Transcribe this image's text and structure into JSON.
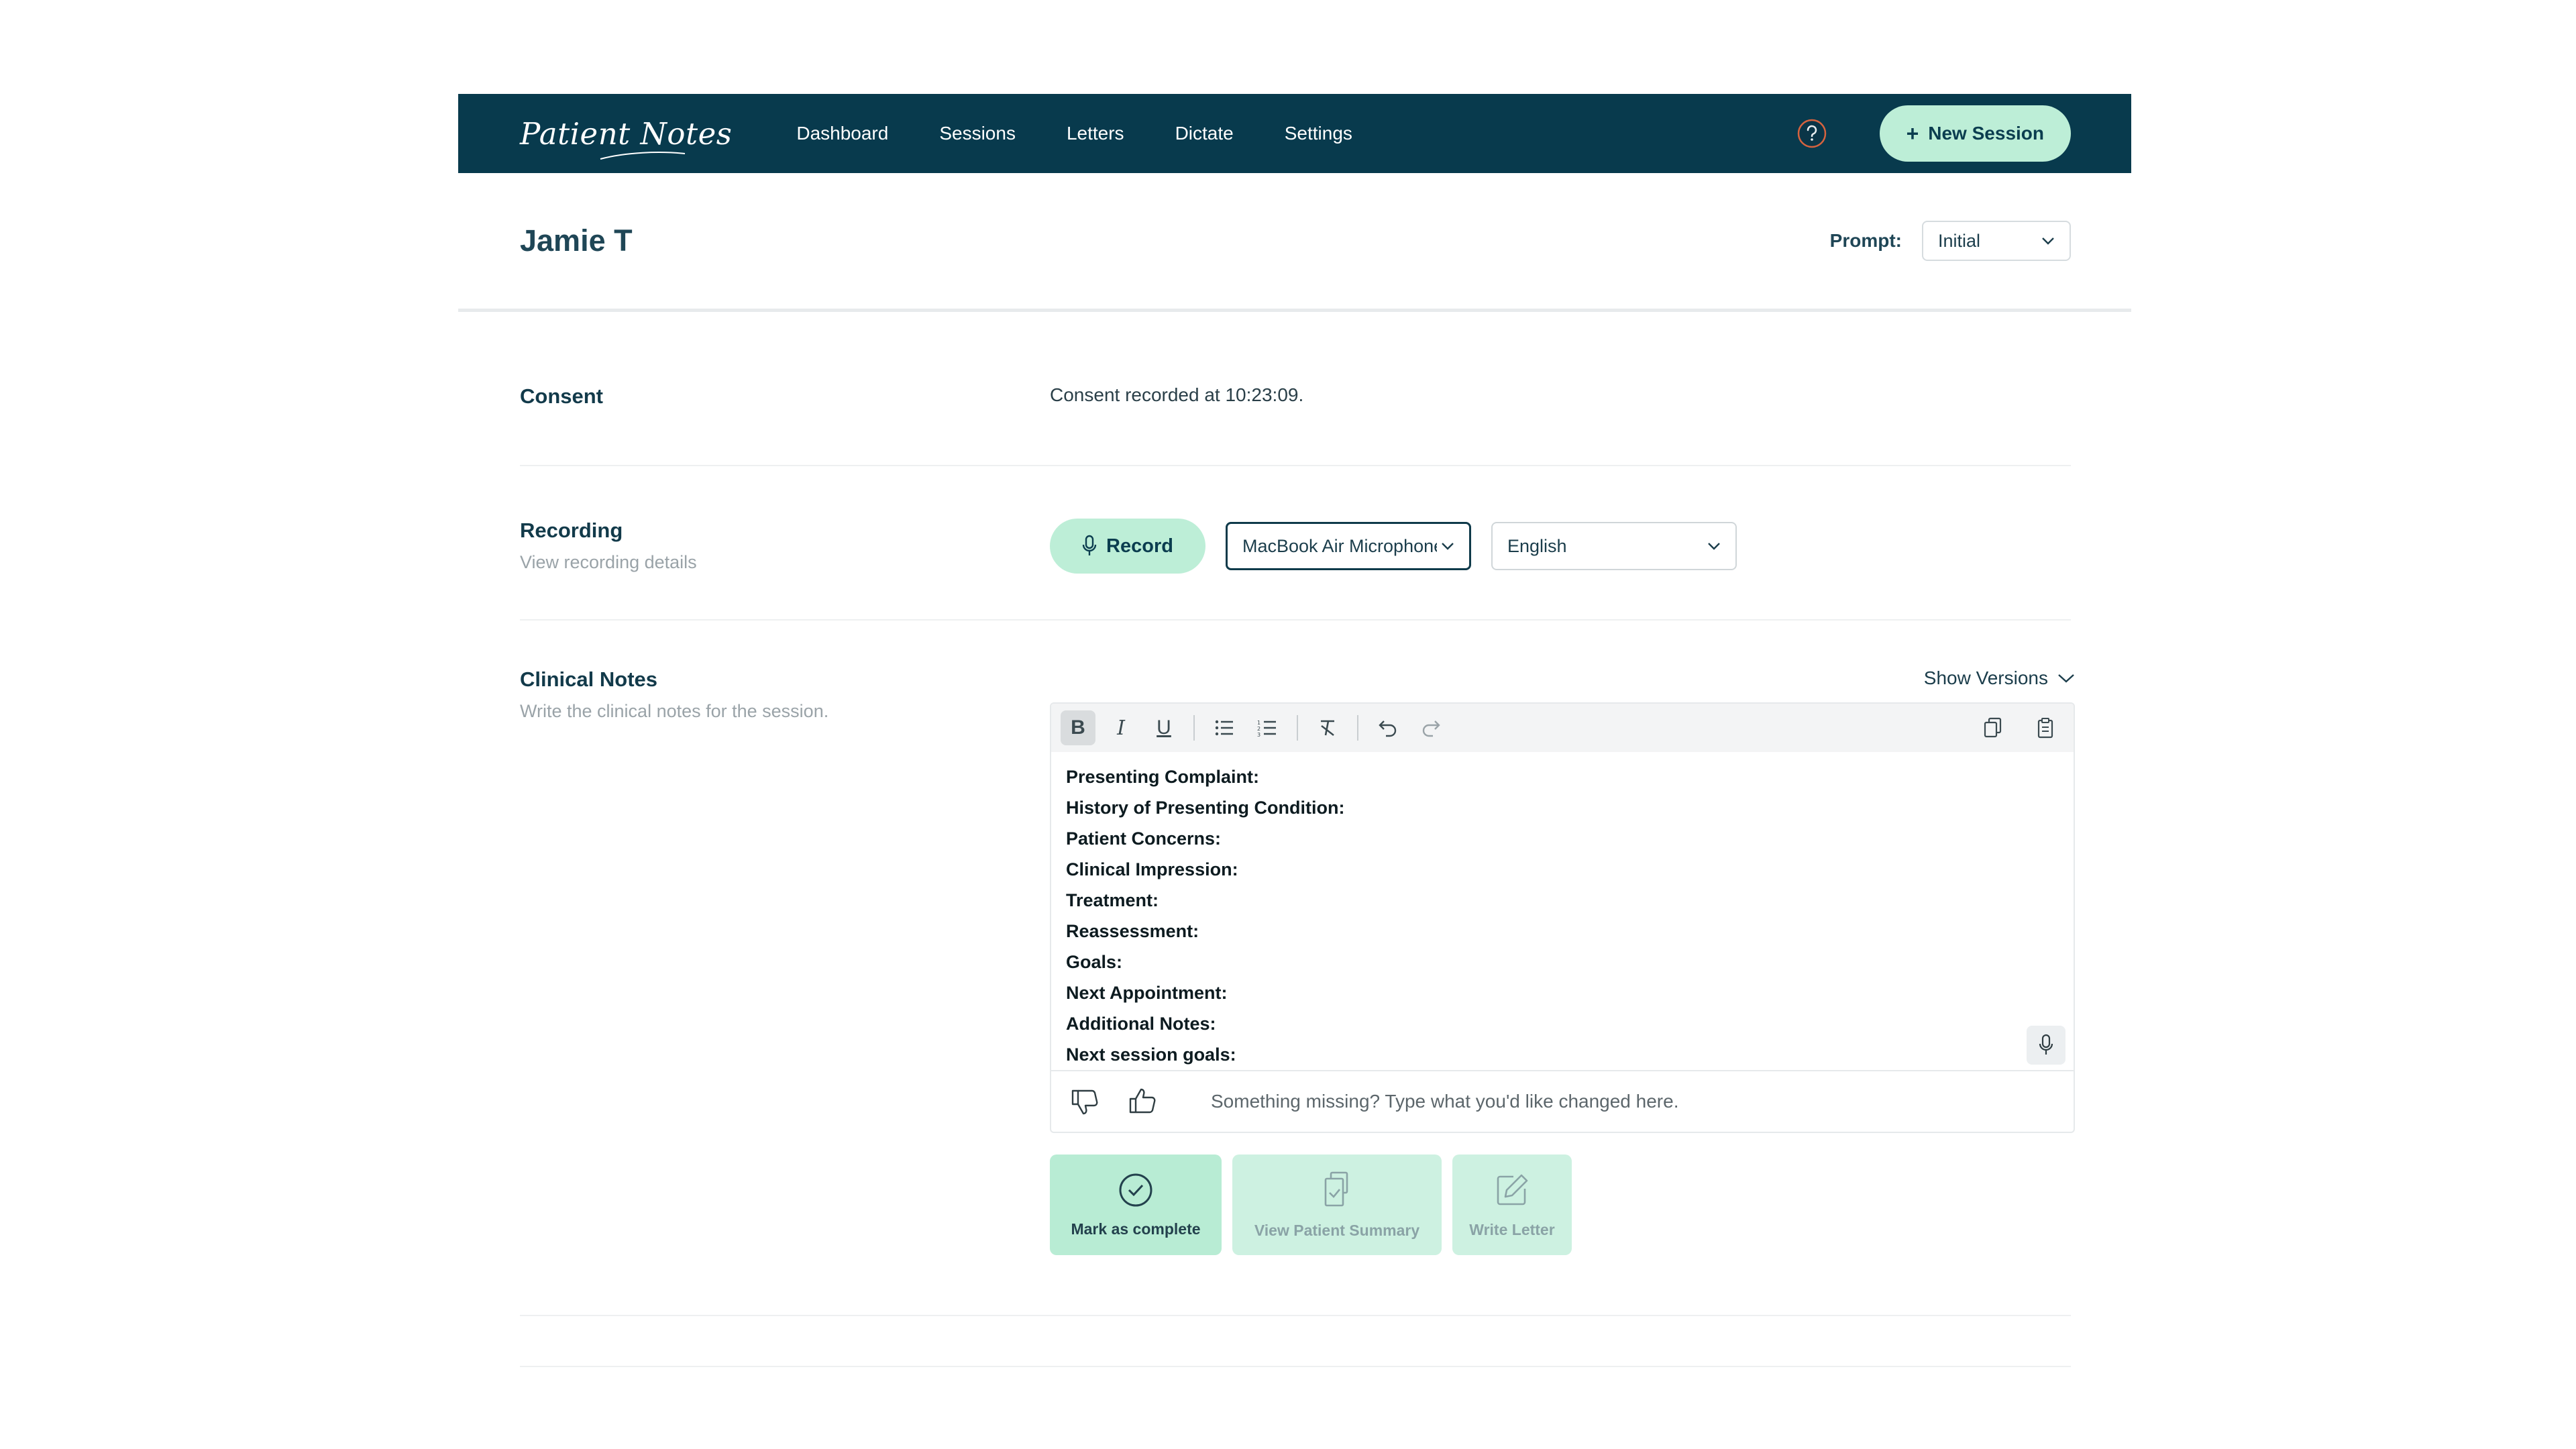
{
  "nav": {
    "logo": "Patient Notes",
    "links": [
      "Dashboard",
      "Sessions",
      "Letters",
      "Dictate",
      "Settings"
    ],
    "help_icon": "help-circle-icon",
    "new_session_label": "New Session"
  },
  "header": {
    "patient_name": "Jamie T",
    "prompt_label": "Prompt:",
    "prompt_value": "Initial"
  },
  "consent": {
    "title": "Consent",
    "text": "Consent recorded at 10:23:09."
  },
  "recording": {
    "title": "Recording",
    "subtitle": "View recording details",
    "record_label": "Record",
    "microphone": "MacBook Air Microphone",
    "language": "English"
  },
  "notes": {
    "title": "Clinical Notes",
    "subtitle": "Write the clinical notes for the session.",
    "show_versions": "Show Versions",
    "lines": [
      "Presenting Complaint:",
      "History of Presenting Condition:",
      "Patient Concerns:",
      "Clinical Impression:",
      "Treatment:",
      "Reassessment:",
      "Goals:",
      "Next Appointment:",
      "Additional Notes:",
      "Next session goals:"
    ],
    "feedback_placeholder": "Something missing? Type what you'd like changed here."
  },
  "actions": {
    "complete": "Mark as complete",
    "summary": "View Patient Summary",
    "letter": "Write Letter"
  },
  "colors": {
    "nav_bg": "#083a4d",
    "accent": "#bdeed7"
  }
}
